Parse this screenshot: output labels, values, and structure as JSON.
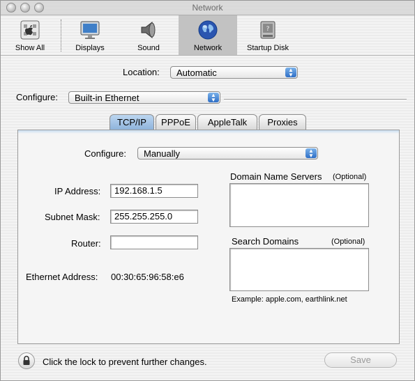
{
  "window": {
    "title": "Network"
  },
  "toolbar": {
    "items": [
      {
        "label": "Show All",
        "icon": "apple-show-all-icon"
      },
      {
        "label": "Displays",
        "icon": "display-icon"
      },
      {
        "label": "Sound",
        "icon": "speaker-icon"
      },
      {
        "label": "Network",
        "icon": "globe-icon",
        "active": true
      },
      {
        "label": "Startup Disk",
        "icon": "disk-icon"
      }
    ]
  },
  "location": {
    "label": "Location:",
    "value": "Automatic"
  },
  "configure_top": {
    "label": "Configure:",
    "value": "Built-in Ethernet"
  },
  "tabs": [
    {
      "label": "TCP/IP",
      "active": true
    },
    {
      "label": "PPPoE"
    },
    {
      "label": "AppleTalk"
    },
    {
      "label": "Proxies"
    }
  ],
  "tcpip": {
    "configure_label": "Configure:",
    "configure_value": "Manually",
    "ip_label": "IP Address:",
    "ip_value": "192.168.1.5",
    "subnet_label": "Subnet Mask:",
    "subnet_value": "255.255.255.0",
    "router_label": "Router:",
    "router_value": "",
    "ethernet_label": "Ethernet Address:",
    "ethernet_value": "00:30:65:96:58:e6",
    "dns_label": "Domain Name Servers",
    "dns_optional": "(Optional)",
    "search_label": "Search Domains",
    "search_optional": "(Optional)",
    "example": "Example: apple.com, earthlink.net"
  },
  "footer": {
    "lock_text": "Click the lock to prevent further changes.",
    "save_label": "Save"
  },
  "colors": {
    "accent": "#2f6fc6",
    "tab_active": "#a8c8e8"
  }
}
